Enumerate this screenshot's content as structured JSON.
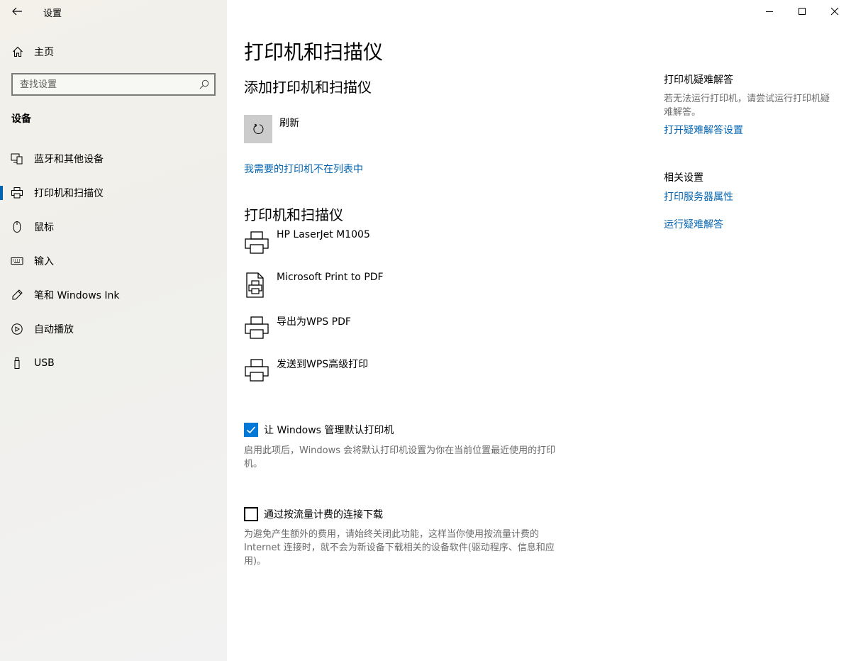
{
  "window": {
    "title": "设置",
    "controls": [
      "minimize",
      "maximize",
      "close"
    ]
  },
  "sidebar": {
    "home_label": "主页",
    "search_placeholder": "查找设置",
    "section_label": "设备",
    "items": [
      {
        "label": "蓝牙和其他设备",
        "icon": "bluetooth-devices-icon",
        "active": false
      },
      {
        "label": "打印机和扫描仪",
        "icon": "printer-icon",
        "active": true
      },
      {
        "label": "鼠标",
        "icon": "mouse-icon",
        "active": false
      },
      {
        "label": "输入",
        "icon": "keyboard-icon",
        "active": false
      },
      {
        "label": "笔和 Windows Ink",
        "icon": "pen-icon",
        "active": false
      },
      {
        "label": "自动播放",
        "icon": "autoplay-icon",
        "active": false
      },
      {
        "label": "USB",
        "icon": "usb-icon",
        "active": false
      }
    ]
  },
  "main": {
    "title": "打印机和扫描仪",
    "add_section": {
      "heading": "添加打印机和扫描仪",
      "refresh_label": "刷新",
      "missing_link": "我需要的打印机不在列表中"
    },
    "printers_section": {
      "heading": "打印机和扫描仪",
      "printers": [
        {
          "name": "HP LaserJet M1005",
          "icon": "printer-icon"
        },
        {
          "name": "Microsoft Print to PDF",
          "icon": "pdf-printer-icon"
        },
        {
          "name": "导出为WPS PDF",
          "icon": "printer-icon"
        },
        {
          "name": "发送到WPS高级打印",
          "icon": "printer-icon"
        }
      ]
    },
    "options": [
      {
        "label": "让 Windows 管理默认打印机",
        "checked": true,
        "description": "启用此项后，Windows 会将默认打印机设置为你在当前位置最近使用的打印机。"
      },
      {
        "label": "通过按流量计费的连接下载",
        "checked": false,
        "description": "为避免产生额外的费用，请始终关闭此功能，这样当你使用按流量计费的 Internet 连接时，就不会为新设备下载相关的设备软件(驱动程序、信息和应用)。"
      }
    ]
  },
  "right_panel": {
    "troubleshoot": {
      "heading": "打印机疑难解答",
      "text": "若无法运行打印机，请尝试运行打印机疑难解答。",
      "link": "打开疑难解答设置"
    },
    "related": {
      "heading": "相关设置",
      "links": [
        "打印服务器属性",
        "运行疑难解答"
      ]
    }
  },
  "colors": {
    "accent": "#0063b1",
    "checkbox_fill": "#0078d7",
    "secondary_text": "#6b6b6b"
  }
}
